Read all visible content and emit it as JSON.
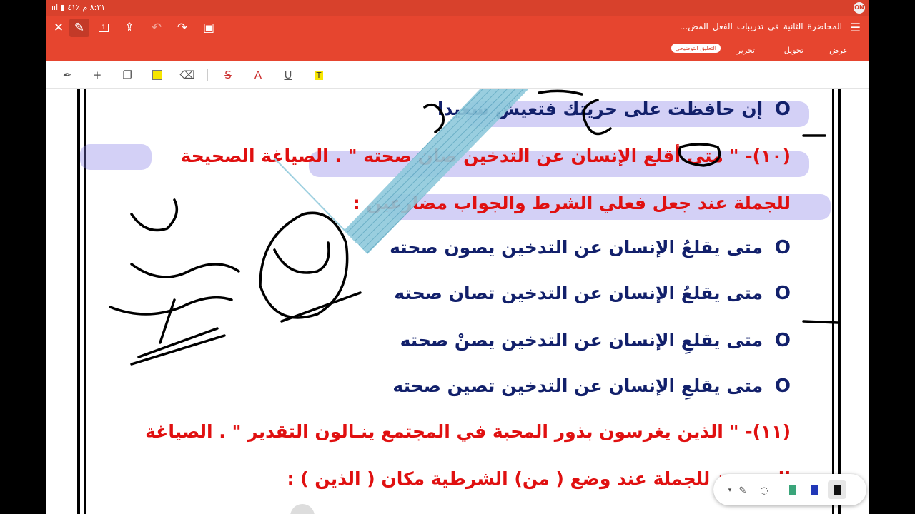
{
  "status": {
    "left_text": "٨:٢١ م  ٪٤١ ▮ ııl",
    "badge": "ON"
  },
  "toolbar": {
    "doc_title": "المحاضرة_الثانية_في_تدريبات_الفعل_المض...",
    "tabs": [
      "عرض",
      "تحويل",
      "تحرير",
      "التعليق التوضيحي"
    ],
    "active_tab": "التعليق التوضيحي",
    "page_icon_label": "1"
  },
  "annotation_tools": [
    "pen-tool",
    "add",
    "shape",
    "highlight-box",
    "eraser",
    "strikethrough",
    "text-color",
    "underline",
    "text-highlight"
  ],
  "lines": [
    {
      "kind": "bullet",
      "color": "blue",
      "text": "إن حافظت على حريتك فتعيش سعيدا"
    },
    {
      "kind": "question",
      "color": "red",
      "text": "(١٠)- \" متى أقلع الإنسان عن التدخين صان صحته \" . الصياغة الصحيحة"
    },
    {
      "kind": "question",
      "color": "red",
      "text": "للجملة عند جعل فعلي الشرط  والجواب مضارعين :"
    },
    {
      "kind": "bullet",
      "color": "blue",
      "text": "متى يقلعُ الإنسان عن التدخين يصون صحته"
    },
    {
      "kind": "bullet",
      "color": "blue",
      "text": "متى يقلعُ الإنسان عن التدخين تصان صحته"
    },
    {
      "kind": "bullet",
      "color": "blue",
      "text": "متى يقلعِ الإنسان عن التدخين يصنْ صحته"
    },
    {
      "kind": "bullet",
      "color": "blue",
      "text": "متى يقلعِ الإنسان عن التدخين تصين صحته"
    },
    {
      "kind": "question",
      "color": "red",
      "text": "(١١)- \" الذين يغرسون بذور المحبة في المجتمع ينـالون التقدير \" . الصياغة"
    },
    {
      "kind": "question",
      "color": "red",
      "text": "الصحيحة للجملة عند وضع ( من) الشرطية مكان ( الذين ) :"
    }
  ],
  "bullet_glyph": "O",
  "colors": {
    "toolbar": "#e6452f",
    "status": "#d8412c",
    "blue_text": "#12206b",
    "red_text": "#e01010",
    "highlight": "#8278e6"
  },
  "palette": [
    "dropdown",
    "lasso",
    "highlighter-green",
    "pen-blue",
    "pen-black"
  ]
}
